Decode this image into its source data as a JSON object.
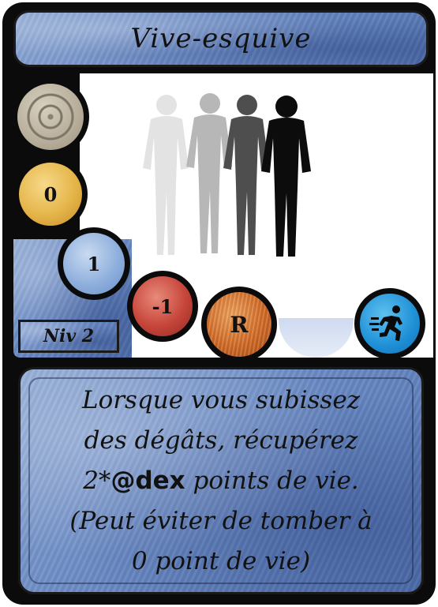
{
  "card": {
    "title": "Vive-esquive",
    "level": "Niv 2",
    "stats": {
      "gold": "0",
      "blue": "1",
      "red": "-1",
      "range": "R"
    },
    "icons": {
      "target": "target-icon",
      "action": "running-man-icon",
      "art": "silhouettes-illustration"
    },
    "description": {
      "line1": "Lorsque vous subissez",
      "line2": "des dégâts, récupérez",
      "line3_pre": "2*",
      "line3_bold": "@dex",
      "line3_post": " points de vie.",
      "line4": "(Peut éviter de tomber à",
      "line5": "0 point de vie)"
    },
    "colors": {
      "frame": "#0b0b0b",
      "panel_blue": "#6c8cc6",
      "gold": "#e5b54a",
      "red": "#c6453a",
      "orange": "#d46b26",
      "action_blue": "#1e8fd6"
    }
  }
}
